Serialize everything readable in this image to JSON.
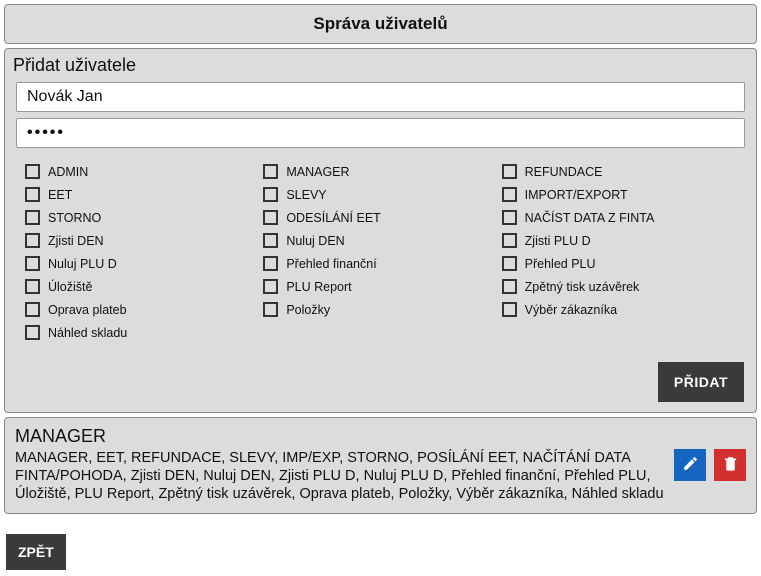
{
  "header": {
    "title": "Správa uživatelů"
  },
  "add_user": {
    "section_title": "Přidat uživatele",
    "name_value": "Novák Jan",
    "password_mask": "•••••",
    "add_button": "PŘIDAT",
    "permissions": {
      "col1": [
        {
          "key": "admin",
          "label": "ADMIN"
        },
        {
          "key": "eet",
          "label": "EET"
        },
        {
          "key": "storno",
          "label": "STORNO"
        },
        {
          "key": "zjisti_den",
          "label": "Zjisti DEN"
        },
        {
          "key": "nuluj_plu_d",
          "label": "Nuluj PLU D"
        },
        {
          "key": "uloziste",
          "label": "Úložiště"
        },
        {
          "key": "oprava_plateb",
          "label": "Oprava plateb"
        },
        {
          "key": "nahled_skladu",
          "label": "Náhled skladu"
        }
      ],
      "col2": [
        {
          "key": "manager",
          "label": "MANAGER"
        },
        {
          "key": "slevy",
          "label": "SLEVY"
        },
        {
          "key": "odesilani_eet",
          "label": "ODESÍLÁNÍ EET"
        },
        {
          "key": "nuluj_den",
          "label": "Nuluj DEN"
        },
        {
          "key": "prehled_financni",
          "label": "Přehled finanční"
        },
        {
          "key": "plu_report",
          "label": "PLU Report"
        },
        {
          "key": "polozky",
          "label": "Položky"
        }
      ],
      "col3": [
        {
          "key": "refundace",
          "label": "REFUNDACE"
        },
        {
          "key": "import_export",
          "label": "IMPORT/EXPORT"
        },
        {
          "key": "nacist_data_finta",
          "label": "NAČÍST DATA Z FINTA"
        },
        {
          "key": "zjisti_plu_d",
          "label": "Zjisti PLU D"
        },
        {
          "key": "prehled_plu",
          "label": "Přehled PLU"
        },
        {
          "key": "zpetny_tisk_uzaverek",
          "label": "Zpětný tisk uzávěrek"
        },
        {
          "key": "vyber_zakaznika",
          "label": "Výběr zákazníka"
        }
      ]
    }
  },
  "users": [
    {
      "name": "MANAGER",
      "permissions_text": "MANAGER, EET, REFUNDACE, SLEVY, IMP/EXP, STORNO, POSÍLÁNÍ EET, NAČÍTÁNÍ DATA FINTA/POHODA, Zjisti DEN, Nuluj DEN, Zjisti PLU D, Nuluj PLU D, Přehled finanční, Přehled PLU, Úložiště, PLU Report, Zpětný tisk uzávěrek, Oprava plateb, Položky, Výběr zákazníka, Náhled skladu"
    }
  ],
  "footer": {
    "back_label": "ZPĚT"
  },
  "colors": {
    "panel_bg": "#dcdcdc",
    "dark_btn": "#3a3a3a",
    "edit_btn": "#1565c0",
    "delete_btn": "#d32f2f"
  }
}
